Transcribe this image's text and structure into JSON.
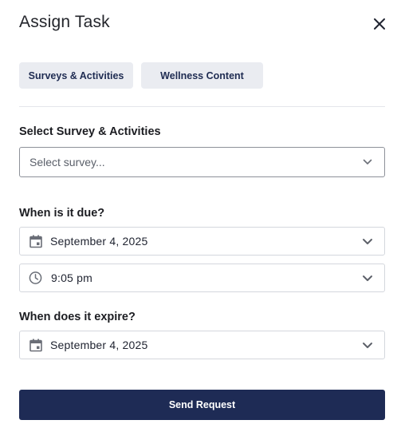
{
  "dialog": {
    "title": "Assign Task"
  },
  "tabs": [
    {
      "label": "Surveys & Activities"
    },
    {
      "label": "Wellness Content"
    }
  ],
  "survey": {
    "label": "Select Survey & Activities",
    "placeholder": "Select survey..."
  },
  "due": {
    "label": "When is it due?",
    "date": "September 4, 2025",
    "time": "9:05 pm"
  },
  "expire": {
    "label": "When does it expire?",
    "date": "September 4, 2025"
  },
  "actions": {
    "send_label": "Send Request"
  },
  "icons": {
    "close": "close-icon",
    "calendar": "calendar-icon",
    "clock": "clock-icon",
    "chevron": "chevron-down-icon"
  },
  "colors": {
    "primary": "#1e2b55",
    "tab_bg": "#eaecf1",
    "tab_text": "#1f2c52"
  }
}
